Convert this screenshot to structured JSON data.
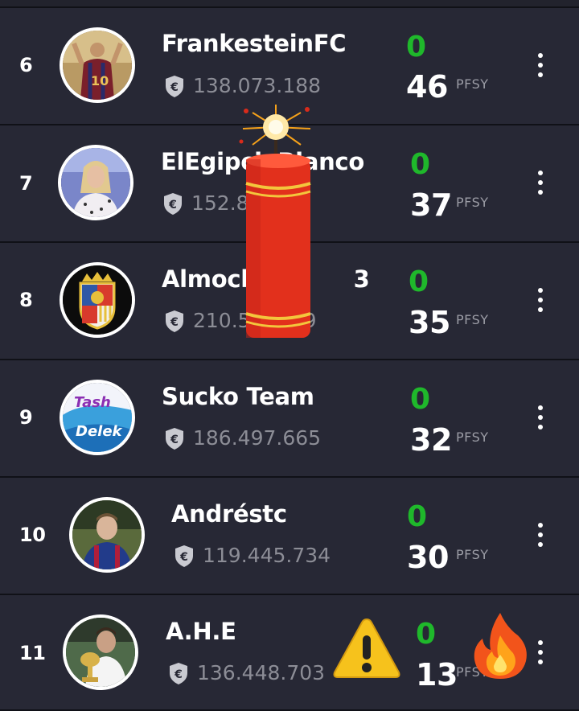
{
  "colors": {
    "background": "#22232d",
    "row": "#272835",
    "accent_green": "#1fb82b",
    "muted": "#8c8d96"
  },
  "currency_icon": "euro-shield-icon",
  "points_unit": "PFSY",
  "rows": [
    {
      "rank": "6",
      "team": "FrankesteinFC",
      "value": "138.073.188",
      "change": "0",
      "points": "46",
      "avatar": "player-shirt-10-avatar"
    },
    {
      "rank": "7",
      "team": "ElEgipcioBlanco",
      "value": "152.8",
      "change": "0",
      "points": "37",
      "avatar": "presenter-avatar"
    },
    {
      "rank": "8",
      "team": "Almoch",
      "team_suffix": "3",
      "value": "210.5",
      "value_suffix": "9",
      "change": "0",
      "points": "35",
      "avatar": "club-crest-avatar"
    },
    {
      "rank": "9",
      "team": "Sucko Team",
      "value": "186.497.665",
      "change": "0",
      "points": "32",
      "avatar": "graffiti-avatar"
    },
    {
      "rank": "10",
      "team": "Andréstc",
      "value": "119.445.734",
      "change": "0",
      "points": "30",
      "avatar": "footballer-avatar"
    },
    {
      "rank": "11",
      "team": "A.H.E",
      "value": "136.448.703",
      "change": "0",
      "points": "13",
      "avatar": "trophy-player-avatar"
    }
  ],
  "stickers": [
    "firecracker-icon",
    "warning-icon",
    "fire-icon"
  ]
}
